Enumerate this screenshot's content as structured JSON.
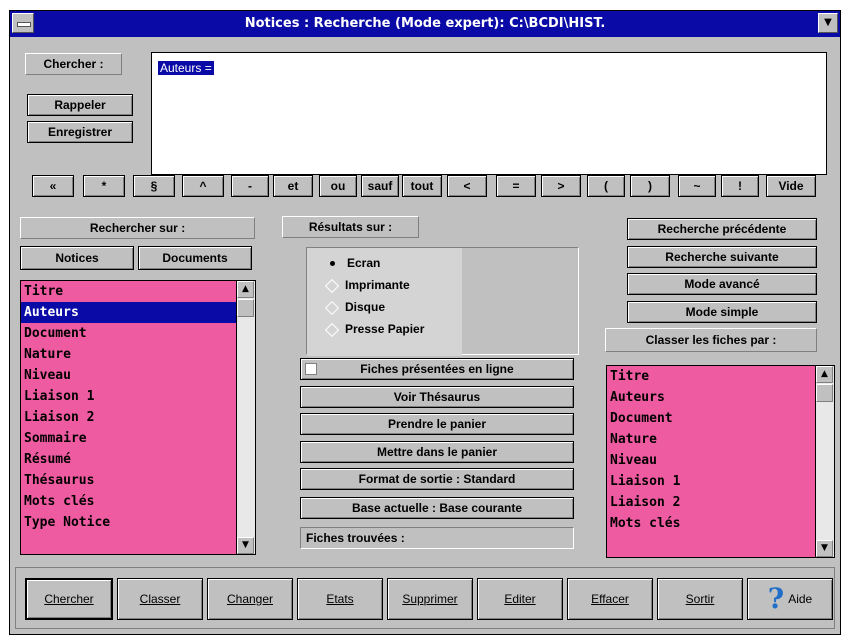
{
  "window": {
    "title": "Notices : Recherche (Mode expert): C:\\BCDI\\HIST.",
    "minimize_glyph": "▼"
  },
  "search": {
    "label": "Chercher :",
    "recall": "Rappeler",
    "save": "Enregistrer",
    "query": "Auteurs  ="
  },
  "operators": [
    "«",
    "*",
    "§",
    "^",
    "-",
    "et",
    "ou",
    "sauf",
    "tout",
    "<",
    "=",
    ">",
    "(",
    ")",
    "~",
    "!",
    "Vide"
  ],
  "left": {
    "title": "Rechercher sur :",
    "tab_notices": "Notices",
    "tab_documents": "Documents",
    "fields": [
      "Titre",
      "Auteurs",
      "Document",
      "Nature",
      "Niveau",
      "Liaison 1",
      "Liaison 2",
      "Sommaire",
      "Résumé",
      "Thésaurus",
      "Mots clés",
      "Type Notice"
    ],
    "selected_index": 1
  },
  "middle": {
    "results_label": "Résultats sur :",
    "outputs": [
      "Ecran",
      "Imprimante",
      "Disque",
      "Presse Papier"
    ],
    "selected_output": 0,
    "inline_checkbox": "Fiches présentées en ligne",
    "see_thesaurus": "Voir Thésaurus",
    "take_cart": "Prendre le panier",
    "put_cart": "Mettre dans le panier",
    "format": "Format de sortie : Standard",
    "base": "Base actuelle : Base courante",
    "found": "Fiches trouvées :"
  },
  "right": {
    "prev": "Recherche précédente",
    "next": "Recherche suivante",
    "advanced": "Mode avancé",
    "simple": "Mode simple",
    "sort_label": "Classer les fiches  par :",
    "sort_fields": [
      "Titre",
      "Auteurs",
      "Document",
      "Nature",
      "Niveau",
      "Liaison 1",
      "Liaison 2",
      "Mots clés"
    ]
  },
  "bottom": {
    "search": "Chercher",
    "sort": "Classer",
    "change": "Changer",
    "states": "Etats",
    "delete": "Supprimer",
    "edit": "Editer",
    "erase": "Effacer",
    "exit": "Sortir",
    "help": "Aide"
  },
  "colors": {
    "titlebar": "#0a0aa6",
    "list_bg": "#ef5ba1",
    "face": "#c0c0c0",
    "help_icon": "#1f6fc9"
  }
}
